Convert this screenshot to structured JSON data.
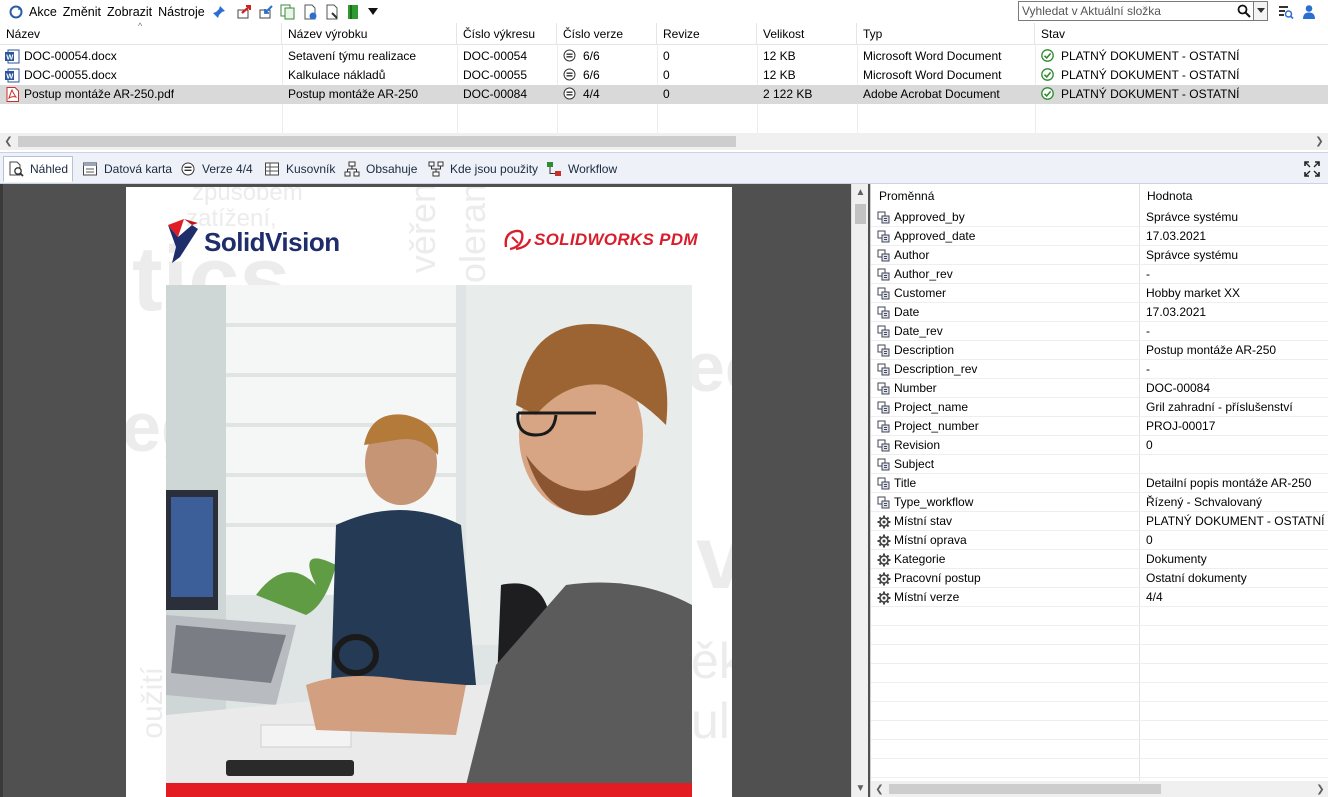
{
  "toolbar": {
    "menus": [
      "Akce",
      "Změnit",
      "Zobrazit",
      "Nástroje"
    ],
    "search_placeholder": "Vyhledat v Aktuální složka"
  },
  "columns": [
    "Název",
    "Název výrobku",
    "Číslo výkresu",
    "Číslo verze",
    "Revize",
    "Velikost",
    "Typ",
    "Stav"
  ],
  "files": [
    {
      "type_icon": "word-doc-icon",
      "name": "DOC-00054.docx",
      "product": "Setavení týmu realizace",
      "drawing": "DOC-00054",
      "version": "6/6",
      "revision": "0",
      "size": "12 KB",
      "type": "Microsoft Word Document",
      "state": "PLATNÝ DOKUMENT - OSTATNÍ"
    },
    {
      "type_icon": "word-doc-icon",
      "name": "DOC-00055.docx",
      "product": "Kalkulace nákladů",
      "drawing": "DOC-00055",
      "version": "6/6",
      "revision": "0",
      "size": "12 KB",
      "type": "Microsoft Word Document",
      "state": "PLATNÝ DOKUMENT - OSTATNÍ"
    },
    {
      "type_icon": "pdf-icon",
      "name": "Postup montáže AR-250.pdf",
      "product": "Postup montáže AR-250",
      "drawing": "DOC-00084",
      "version": "4/4",
      "revision": "0",
      "size": "2 122 KB",
      "type": "Adobe Acrobat Document",
      "state": "PLATNÝ DOKUMENT - OSTATNÍ"
    }
  ],
  "selected_row": 2,
  "tabs": [
    {
      "label": "Náhled",
      "icon": "preview-icon",
      "active": true
    },
    {
      "label": "Datová karta",
      "icon": "datacard-icon"
    },
    {
      "label": "Verze 4/4",
      "icon": "version-icon"
    },
    {
      "label": "Kusovník",
      "icon": "bom-icon"
    },
    {
      "label": "Obsahuje",
      "icon": "contains-icon"
    },
    {
      "label": "Kde jsou použity",
      "icon": "where-used-icon"
    },
    {
      "label": "Workflow",
      "icon": "workflow-icon"
    }
  ],
  "preview": {
    "logo_left": "SolidVision",
    "logo_right": "SOLIDWORKS PDM",
    "bg_words": [
      "způsobem",
      "zatížení,",
      "tics",
      "věřen",
      "oleran",
      "ec",
      "eg",
      "v",
      "ěk",
      "ul",
      "oužití"
    ]
  },
  "props": {
    "headers": [
      "Proměnná",
      "Hodnota"
    ],
    "rows": [
      {
        "icon": "variable-icon",
        "name": "Approved_by",
        "value": "Správce systému"
      },
      {
        "icon": "variable-icon",
        "name": "Approved_date",
        "value": "17.03.2021"
      },
      {
        "icon": "variable-icon",
        "name": "Author",
        "value": "Správce systému"
      },
      {
        "icon": "variable-icon",
        "name": "Author_rev",
        "value": "-"
      },
      {
        "icon": "variable-icon",
        "name": "Customer",
        "value": "Hobby market XX"
      },
      {
        "icon": "variable-icon",
        "name": "Date",
        "value": "17.03.2021"
      },
      {
        "icon": "variable-icon",
        "name": "Date_rev",
        "value": "-"
      },
      {
        "icon": "variable-icon",
        "name": "Description",
        "value": "Postup montáže AR-250"
      },
      {
        "icon": "variable-icon",
        "name": "Description_rev",
        "value": "-"
      },
      {
        "icon": "variable-icon",
        "name": "Number",
        "value": "DOC-00084"
      },
      {
        "icon": "variable-icon",
        "name": "Project_name",
        "value": "Gril zahradní - příslušenství"
      },
      {
        "icon": "variable-icon",
        "name": "Project_number",
        "value": "PROJ-00017"
      },
      {
        "icon": "variable-icon",
        "name": "Revision",
        "value": "0"
      },
      {
        "icon": "variable-icon",
        "name": "Subject",
        "value": ""
      },
      {
        "icon": "variable-icon",
        "name": "Title",
        "value": "Detailní popis montáže AR-250"
      },
      {
        "icon": "variable-icon",
        "name": "Type_workflow",
        "value": "Řízený - Schvalovaný"
      },
      {
        "icon": "system-variable-icon",
        "name": "Místní stav",
        "value": "PLATNÝ DOKUMENT - OSTATNÍ"
      },
      {
        "icon": "system-variable-icon",
        "name": "Místní oprava",
        "value": "0"
      },
      {
        "icon": "system-variable-icon",
        "name": "Kategorie",
        "value": "Dokumenty"
      },
      {
        "icon": "system-variable-icon",
        "name": "Pracovní postup",
        "value": "Ostatní dokumenty"
      },
      {
        "icon": "system-variable-icon",
        "name": "Místní verze",
        "value": "4/4"
      }
    ]
  },
  "colors": {
    "selection": "#d9d9d9",
    "accent_blue": "#1f5fb4",
    "brand_red": "#e31b23",
    "brand_navy": "#1f2d6a",
    "state_green": "#2e8b2e"
  }
}
